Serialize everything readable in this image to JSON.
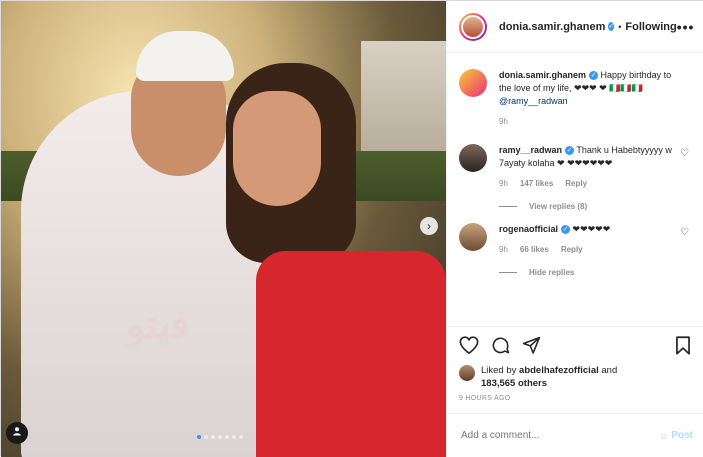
{
  "header": {
    "username": "donia.samir.ghanem",
    "separator": "•",
    "follow_label": "Following",
    "more_label": "•••"
  },
  "caption": {
    "username": "donia.samir.ghanem",
    "text": "Happy birthday to the love of my life, ❤❤❤ ❤ 🇮🇹🇮🇹🇮🇹",
    "mention": "@ramy__radwan",
    "time": "9h"
  },
  "comments": [
    {
      "username": "ramy__radwan",
      "text": "Thank u Habebtyyyyy w 7ayaty kolaha ❤ ❤❤❤❤❤❤",
      "time": "9h",
      "likes": "147 likes",
      "reply_label": "Reply",
      "replies_label": "View replies (8)"
    },
    {
      "username": "rogenaofficial",
      "text": "❤❤❤❤❤",
      "time": "9h",
      "likes": "66 likes",
      "reply_label": "Reply",
      "replies_label": "Hide replies"
    }
  ],
  "likes": {
    "prefix": "Liked by",
    "user": "abdelhafezofficial",
    "middle": "and",
    "count": "183,565 others"
  },
  "timestamp": "9 HOURS AGO",
  "add_comment": {
    "placeholder": "Add a comment...",
    "post_label": "Post"
  },
  "photo": {
    "watermark": "فيتو"
  },
  "colors": {
    "accent": "#3897f0",
    "post_disabled": "#b2dffc",
    "muted": "#8e8e8e"
  },
  "icons": [
    "heart-icon",
    "comment-icon",
    "share-icon",
    "bookmark-icon",
    "verified-icon",
    "more-icon",
    "next-arrow-icon",
    "tag-user-icon",
    "emoji-icon"
  ]
}
